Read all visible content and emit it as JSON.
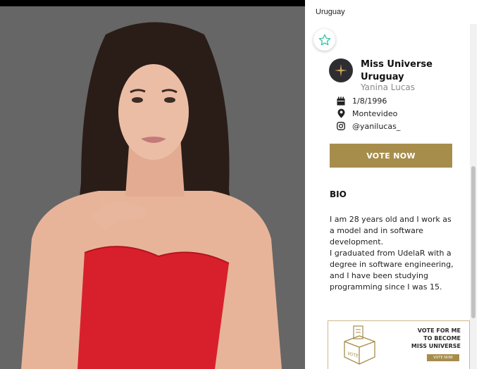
{
  "panel": {
    "country": "Uruguay",
    "title": "Miss Universe Uruguay",
    "contestant_name": "Yanina Lucas",
    "info": {
      "birthdate": "1/8/1996",
      "city": "Montevideo",
      "instagram": "@yanilucas_"
    },
    "vote_label": "VOTE NOW",
    "bio_heading": "BIO",
    "bio_text": "I am 28 years old and I work as a model and in software development.\nI graduated from UdelaR with a degree in software engineering, and I have been studying programming since I was 15.",
    "banner": {
      "text": "VOTE FOR ME\nTO BECOME\nMISS UNIVERSE",
      "box_label": "VOTE",
      "button_label": "VOTE NOW"
    }
  },
  "icons": {
    "favorite": "star-outline-icon",
    "logo": "sparkle-star-icon",
    "birthdate": "calendar-icon",
    "city": "location-pin-icon",
    "instagram": "instagram-icon"
  },
  "colors": {
    "accent_gold": "#a78d4c",
    "star_teal": "#3cc4a4",
    "photo_background": "#666666",
    "dress_red": "#d8202c"
  }
}
